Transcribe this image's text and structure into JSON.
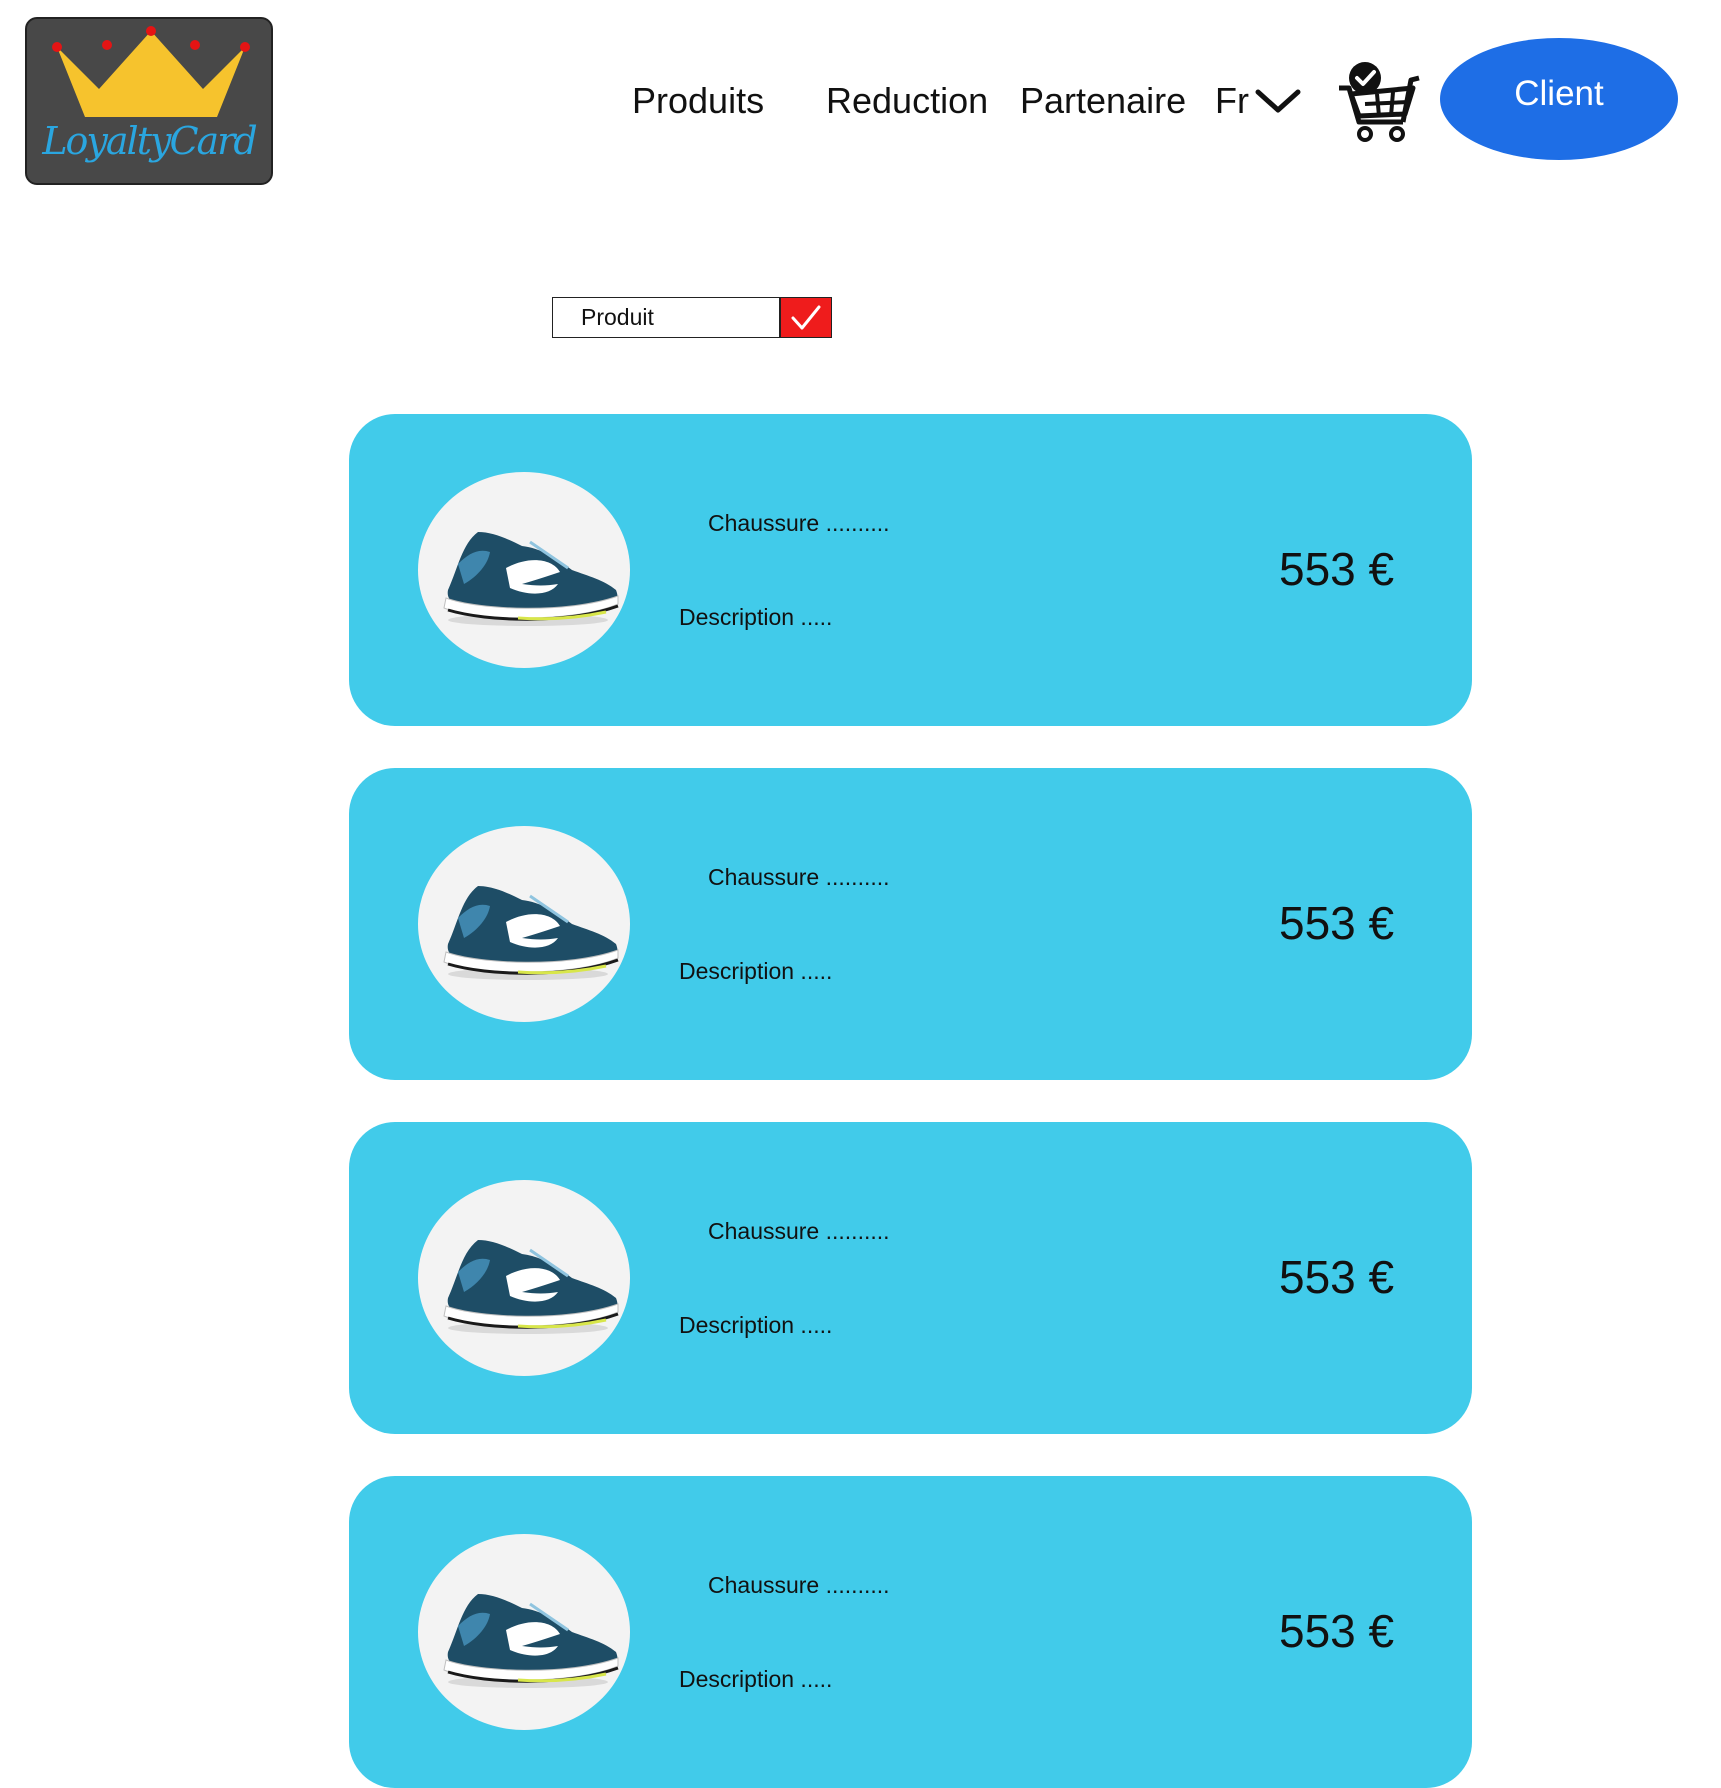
{
  "header": {
    "logo_text": "LoyaltyCard",
    "nav": [
      "Produits",
      "Reduction",
      "Partenaire"
    ],
    "language": "Fr",
    "client_button": "Client"
  },
  "filter": {
    "value": "Produit"
  },
  "colors": {
    "card_bg": "#41cbea",
    "client_button_bg": "#1e6ee6",
    "filter_button_bg": "#ef1c1c",
    "logo_bg": "#484848",
    "crown": "#f6c32d",
    "crown_jewels": "#e51414"
  },
  "products": [
    {
      "name": "Chaussure ..........",
      "description": "Description .....",
      "price": "553 €"
    },
    {
      "name": "Chaussure ..........",
      "description": "Description .....",
      "price": "553 €"
    },
    {
      "name": "Chaussure ..........",
      "description": "Description .....",
      "price": "553 €"
    },
    {
      "name": "Chaussure ..........",
      "description": "Description .....",
      "price": "553 €"
    }
  ]
}
